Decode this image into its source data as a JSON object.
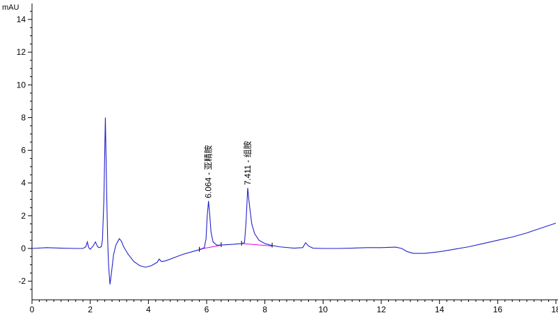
{
  "chart_data": {
    "type": "line",
    "ylabel": "mAU",
    "xlim": [
      0,
      18
    ],
    "ylim": [
      -2.5,
      15
    ],
    "x_ticks": [
      "0",
      "2",
      "4",
      "6",
      "8",
      "10",
      "12",
      "14",
      "16",
      "18"
    ],
    "y_ticks": [
      "-2",
      "0",
      "2",
      "4",
      "6",
      "8",
      "10",
      "12",
      "14"
    ],
    "series": [
      {
        "color": "#2020cc",
        "points": [
          [
            0.0,
            0.0
          ],
          [
            0.5,
            0.05
          ],
          [
            1.0,
            0.02
          ],
          [
            1.5,
            0.0
          ],
          [
            1.75,
            0.0
          ],
          [
            1.85,
            0.1
          ],
          [
            1.9,
            0.4
          ],
          [
            1.95,
            0.05
          ],
          [
            2.0,
            -0.05
          ],
          [
            2.1,
            0.15
          ],
          [
            2.18,
            0.4
          ],
          [
            2.25,
            0.12
          ],
          [
            2.3,
            0.05
          ],
          [
            2.38,
            0.1
          ],
          [
            2.42,
            0.5
          ],
          [
            2.47,
            3.0
          ],
          [
            2.52,
            8.0
          ],
          [
            2.57,
            3.0
          ],
          [
            2.6,
            0.5
          ],
          [
            2.63,
            -1.0
          ],
          [
            2.68,
            -2.2
          ],
          [
            2.73,
            -1.5
          ],
          [
            2.8,
            -0.4
          ],
          [
            2.88,
            0.2
          ],
          [
            2.94,
            0.4
          ],
          [
            3.0,
            0.6
          ],
          [
            3.07,
            0.45
          ],
          [
            3.15,
            0.1
          ],
          [
            3.3,
            -0.35
          ],
          [
            3.5,
            -0.8
          ],
          [
            3.7,
            -1.05
          ],
          [
            3.9,
            -1.15
          ],
          [
            4.1,
            -1.05
          ],
          [
            4.3,
            -0.85
          ],
          [
            4.37,
            -0.65
          ],
          [
            4.45,
            -0.8
          ],
          [
            4.6,
            -0.75
          ],
          [
            4.9,
            -0.55
          ],
          [
            5.2,
            -0.35
          ],
          [
            5.5,
            -0.2
          ],
          [
            5.8,
            -0.05
          ],
          [
            5.92,
            0.05
          ],
          [
            5.98,
            0.6
          ],
          [
            6.02,
            2.0
          ],
          [
            6.064,
            2.9
          ],
          [
            6.1,
            2.2
          ],
          [
            6.15,
            1.0
          ],
          [
            6.22,
            0.4
          ],
          [
            6.35,
            0.2
          ],
          [
            6.6,
            0.22
          ],
          [
            6.9,
            0.25
          ],
          [
            7.2,
            0.3
          ],
          [
            7.3,
            0.35
          ],
          [
            7.35,
            1.5
          ],
          [
            7.411,
            3.7
          ],
          [
            7.46,
            2.8
          ],
          [
            7.55,
            1.5
          ],
          [
            7.65,
            0.9
          ],
          [
            7.8,
            0.5
          ],
          [
            8.0,
            0.3
          ],
          [
            8.2,
            0.2
          ],
          [
            8.5,
            0.1
          ],
          [
            9.0,
            0.02
          ],
          [
            9.3,
            0.05
          ],
          [
            9.4,
            0.35
          ],
          [
            9.5,
            0.15
          ],
          [
            9.65,
            0.02
          ],
          [
            10.0,
            0.0
          ],
          [
            10.5,
            0.0
          ],
          [
            11.0,
            0.02
          ],
          [
            11.5,
            0.05
          ],
          [
            12.0,
            0.05
          ],
          [
            12.5,
            0.08
          ],
          [
            12.7,
            0.0
          ],
          [
            12.9,
            -0.2
          ],
          [
            13.1,
            -0.3
          ],
          [
            13.5,
            -0.3
          ],
          [
            14.0,
            -0.2
          ],
          [
            14.5,
            -0.05
          ],
          [
            15.0,
            0.1
          ],
          [
            15.5,
            0.3
          ],
          [
            16.0,
            0.5
          ],
          [
            16.5,
            0.7
          ],
          [
            17.0,
            0.95
          ],
          [
            17.5,
            1.25
          ],
          [
            18.0,
            1.55
          ]
        ]
      }
    ],
    "integration_baselines": [
      {
        "color": "#e000e0",
        "points": [
          [
            5.75,
            -0.05
          ],
          [
            6.5,
            0.2
          ]
        ]
      },
      {
        "color": "#e000e0",
        "points": [
          [
            7.2,
            0.3
          ],
          [
            8.25,
            0.15
          ]
        ]
      }
    ],
    "baseline_markers": [
      5.75,
      6.5,
      7.2,
      8.25
    ],
    "peaks": [
      {
        "x": 6.064,
        "y": 2.9,
        "label": "6.064 - 亚精胺"
      },
      {
        "x": 7.411,
        "y": 3.7,
        "label": "7.411 - 组胺"
      }
    ]
  }
}
